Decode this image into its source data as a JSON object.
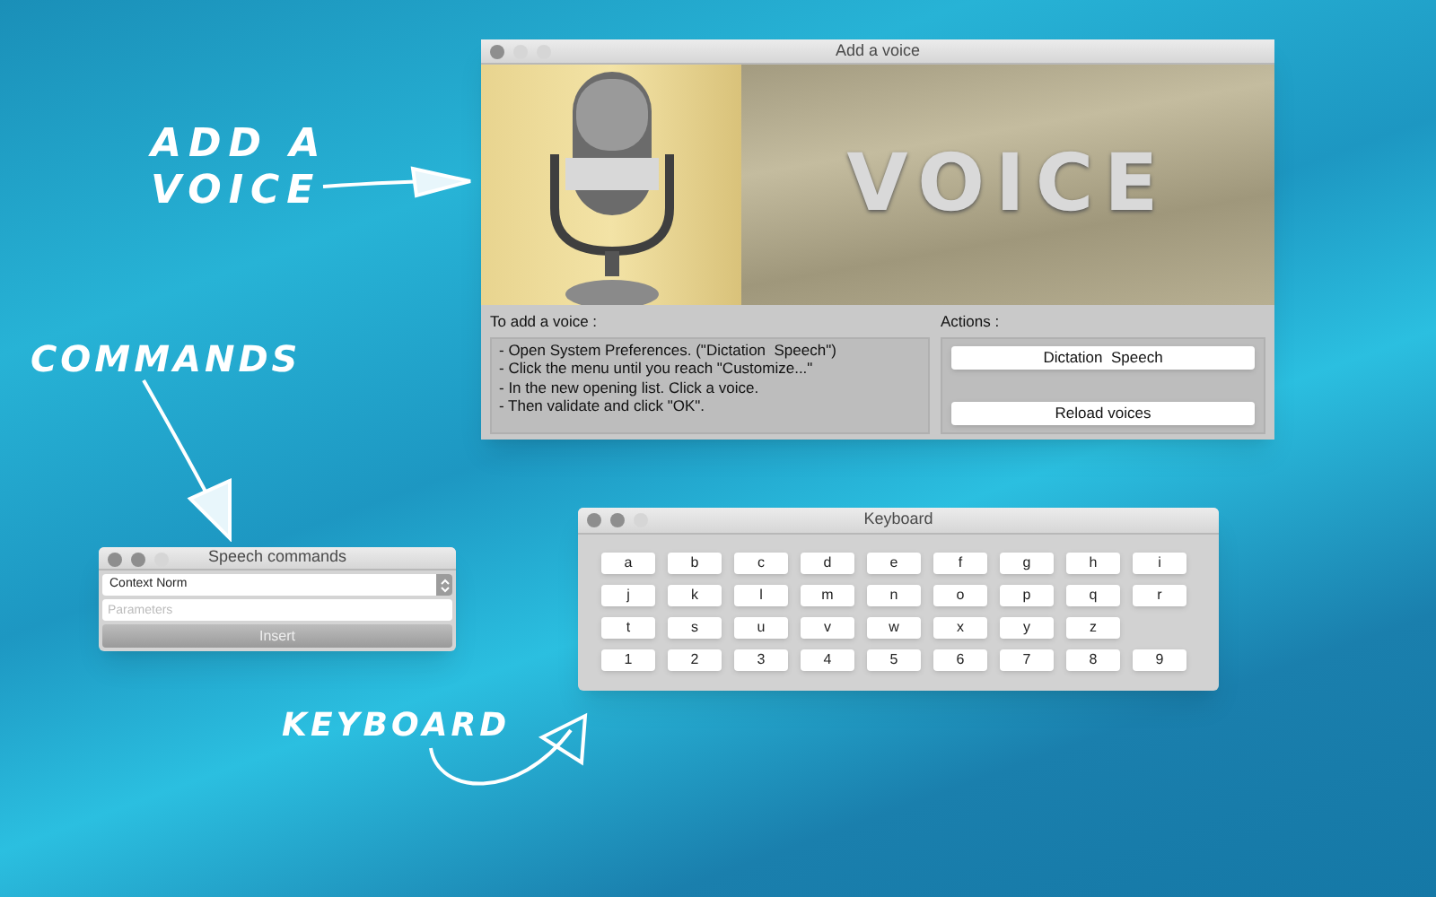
{
  "voice_window": {
    "title": "Add a voice",
    "banner_text": "VOICE",
    "instructions_heading": "To add a voice :",
    "instructions": [
      "- Open System Preferences. (\"Dictation  Speech\")",
      "- Click the menu until you reach \"Customize...\"",
      "- In the new opening list. Click a voice.",
      "- Then validate and click \"OK\"."
    ],
    "actions_heading": "Actions :",
    "buttons": [
      "Dictation  Speech",
      "Reload voices"
    ]
  },
  "commands_window": {
    "title": "Speech commands",
    "select_value": "Context Norm",
    "placeholder": "Parameters",
    "button": "Insert"
  },
  "keyboard_window": {
    "title": "Keyboard",
    "rows": [
      [
        "a",
        "b",
        "c",
        "d",
        "e",
        "f",
        "g",
        "h",
        "i"
      ],
      [
        "j",
        "k",
        "l",
        "m",
        "n",
        "o",
        "p",
        "q",
        "r"
      ],
      [
        "t",
        "s",
        "u",
        "v",
        "w",
        "x",
        "y",
        "z"
      ],
      [
        "1",
        "2",
        "3",
        "4",
        "5",
        "6",
        "7",
        "8",
        "9"
      ]
    ]
  },
  "annotations": [
    {
      "lines": [
        "ADD A",
        "VOICE"
      ]
    },
    {
      "lines": [
        "COMMANDS"
      ]
    },
    {
      "lines": [
        "KEYBOARD"
      ]
    }
  ]
}
